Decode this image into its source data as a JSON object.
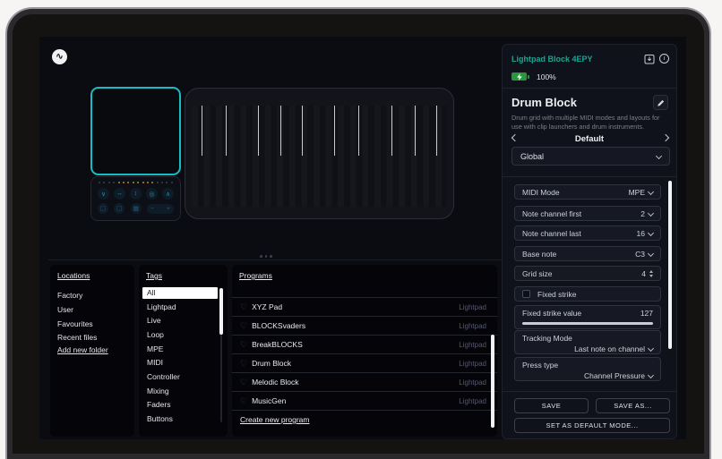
{
  "icons": {
    "logo_wave": "∿",
    "heart": "♡",
    "info": "i",
    "minus": "−",
    "plus": "+",
    "loop_row1": [
      "∨",
      "↔",
      "↕",
      "◎",
      "∧"
    ],
    "loop_row2": [
      "▢",
      "▢",
      "▦"
    ]
  },
  "device_header": {
    "name": "Lightpad Block 4EPY",
    "battery": "100%"
  },
  "mode": {
    "title": "Drum Block",
    "description": "Drum grid with multiple MIDI modes and layouts for use with clip launchers and drum instruments.",
    "preset": "Default",
    "scope": "Global"
  },
  "settings": {
    "midi_mode": {
      "label": "MIDI Mode",
      "value": "MPE"
    },
    "note_channel_first": {
      "label": "Note channel first",
      "value": "2"
    },
    "note_channel_last": {
      "label": "Note channel last",
      "value": "16"
    },
    "base_note": {
      "label": "Base note",
      "value": "C3"
    },
    "grid_size": {
      "label": "Grid size",
      "value": "4"
    },
    "fixed_strike": {
      "label": "Fixed strike"
    },
    "fixed_strike_value": {
      "label": "Fixed strike value",
      "value": "127"
    },
    "tracking_mode": {
      "label": "Tracking Mode",
      "value": "Last note on channel"
    },
    "press_type": {
      "label": "Press type",
      "value": "Channel Pressure"
    }
  },
  "actions": {
    "save": "SAVE",
    "save_as": "SAVE AS...",
    "set_default": "SET AS DEFAULT MODE..."
  },
  "locations": {
    "header": "Locations",
    "items": [
      "Factory",
      "User",
      "Favourites",
      "Recent files"
    ],
    "add": "Add new folder"
  },
  "tags": {
    "header": "Tags",
    "items": [
      "All",
      "Lightpad",
      "Live",
      "Loop",
      "MPE",
      "MIDI",
      "Controller",
      "Mixing",
      "Faders",
      "Buttons"
    ]
  },
  "programs": {
    "header": "Programs",
    "create": "Create new program",
    "items": [
      {
        "name": "XYZ Pad",
        "tag": "Lightpad"
      },
      {
        "name": "BLOCKSvaders",
        "tag": "Lightpad"
      },
      {
        "name": "BreakBLOCKS",
        "tag": "Lightpad"
      },
      {
        "name": "Drum Block",
        "tag": "Lightpad"
      },
      {
        "name": "Melodic Block",
        "tag": "Lightpad"
      },
      {
        "name": "MusicGen",
        "tag": "Lightpad"
      }
    ]
  },
  "colors": {
    "accent_teal": "#1fa390",
    "lightpad_border": "#17bdc6",
    "battery_green": "#27963c",
    "amber_led": "#c08427"
  }
}
